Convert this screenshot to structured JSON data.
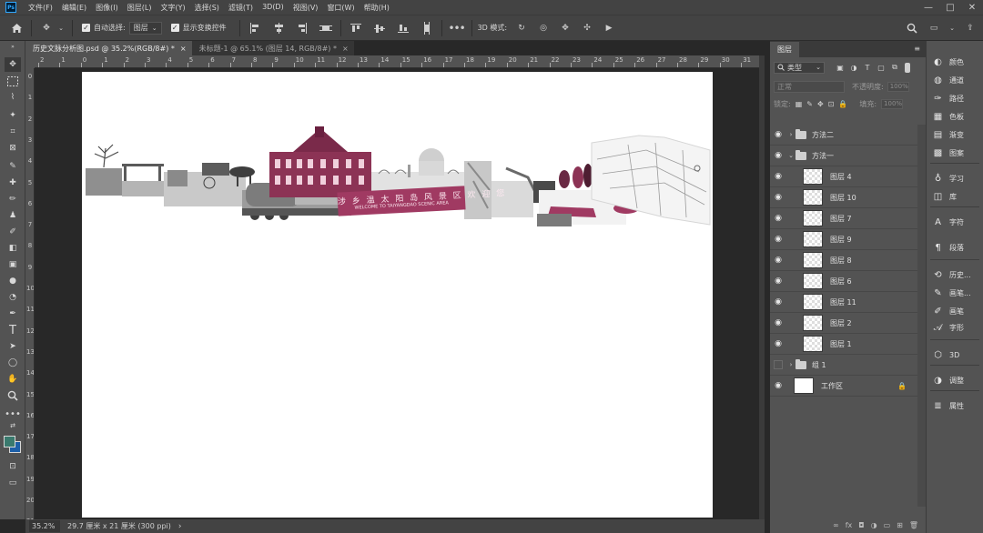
{
  "app": {
    "logo": "Ps"
  },
  "menu": [
    "文件(F)",
    "编辑(E)",
    "图像(I)",
    "图层(L)",
    "文字(Y)",
    "选择(S)",
    "滤镜(T)",
    "3D(D)",
    "视图(V)",
    "窗口(W)",
    "帮助(H)"
  ],
  "options": {
    "auto_select_label": "自动选择:",
    "auto_select_value": "图层",
    "show_transform_label": "显示变换控件",
    "mode_3d_label": "3D 模式:"
  },
  "tabs": [
    {
      "label": "历史文脉分析图.psd @ 35.2%(RGB/8#) *",
      "close": "×"
    },
    {
      "label": "未标题-1 @ 65.1% (图层 14, RGB/8#) *",
      "close": "×"
    }
  ],
  "ruler_top": [
    "2",
    "1",
    "0",
    "1",
    "2",
    "3",
    "4",
    "5",
    "6",
    "7",
    "8",
    "9",
    "10",
    "11",
    "12",
    "13",
    "14",
    "15",
    "16",
    "17",
    "18",
    "19",
    "20",
    "21",
    "22",
    "23",
    "24",
    "25",
    "26",
    "27",
    "28",
    "29",
    "30",
    "31"
  ],
  "ruler_left": [
    "0",
    "1",
    "2",
    "3",
    "4",
    "5",
    "6",
    "7",
    "8",
    "9",
    "10",
    "11",
    "12",
    "13",
    "14",
    "15",
    "16",
    "17",
    "18",
    "19",
    "20",
    "21"
  ],
  "canvas": {
    "banner_title": "涉 乡 温 太 阳 岛 风 景 区 欢 迎 您",
    "banner_subtitle": "WELCOME TO TAIYANGDAO SCENIC AREA"
  },
  "status": {
    "zoom": "35.2%",
    "doc_size": "29.7 厘米 x 21 厘米 (300 ppi)",
    "arrow": "›"
  },
  "layers_panel": {
    "tab": "图层",
    "filter_kind": "类型",
    "blend_mode": "正常",
    "opacity_label": "不透明度:",
    "opacity_value": "100%",
    "lock_label": "锁定:",
    "fill_label": "填充:",
    "fill_value": "100%",
    "layers": [
      {
        "name": "方法二",
        "type": "group",
        "visible": true,
        "expanded": false,
        "indent": 0
      },
      {
        "name": "方法一",
        "type": "group",
        "visible": true,
        "expanded": true,
        "indent": 0
      },
      {
        "name": "图层 4",
        "type": "layer",
        "visible": true,
        "indent": 1
      },
      {
        "name": "图层 10",
        "type": "layer",
        "visible": true,
        "indent": 1
      },
      {
        "name": "图层 7",
        "type": "layer",
        "visible": true,
        "indent": 1
      },
      {
        "name": "图层 9",
        "type": "layer",
        "visible": true,
        "indent": 1
      },
      {
        "name": "图层 8",
        "type": "layer",
        "visible": true,
        "indent": 1
      },
      {
        "name": "图层 6",
        "type": "layer",
        "visible": true,
        "indent": 1
      },
      {
        "name": "图层 11",
        "type": "layer",
        "visible": true,
        "indent": 1
      },
      {
        "name": "图层 2",
        "type": "layer",
        "visible": true,
        "indent": 1
      },
      {
        "name": "图层 1",
        "type": "layer",
        "visible": true,
        "indent": 1
      },
      {
        "name": "组 1",
        "type": "group",
        "visible": false,
        "expanded": false,
        "indent": 0
      },
      {
        "name": "工作区",
        "type": "artboard",
        "visible": true,
        "locked": true,
        "indent": 0
      }
    ]
  },
  "right_dock": [
    {
      "label": "颜色",
      "icon": "color-icon"
    },
    {
      "label": "通道",
      "icon": "channels-icon"
    },
    {
      "label": "路径",
      "icon": "paths-icon"
    },
    {
      "label": "色板",
      "icon": "swatches-icon"
    },
    {
      "label": "渐变",
      "icon": "gradient-icon"
    },
    {
      "label": "图案",
      "icon": "patterns-icon"
    },
    {
      "label": "学习",
      "icon": "learn-icon"
    },
    {
      "label": "库",
      "icon": "libraries-icon"
    },
    {
      "label": "字符",
      "icon": "character-icon"
    },
    {
      "label": "段落",
      "icon": "paragraph-icon"
    },
    {
      "label": "历史...",
      "icon": "history-icon"
    },
    {
      "label": "画笔...",
      "icon": "brush-settings-icon"
    },
    {
      "label": "画笔",
      "icon": "brushes-icon"
    },
    {
      "label": "字形",
      "icon": "glyphs-icon"
    },
    {
      "label": "3D",
      "icon": "3d-icon"
    },
    {
      "label": "调整",
      "icon": "adjustments-icon"
    },
    {
      "label": "属性",
      "icon": "properties-icon"
    }
  ],
  "colors": {
    "foreground": "#3a7a6e",
    "background": "#1d5fa8",
    "banner": "#a03a62"
  }
}
